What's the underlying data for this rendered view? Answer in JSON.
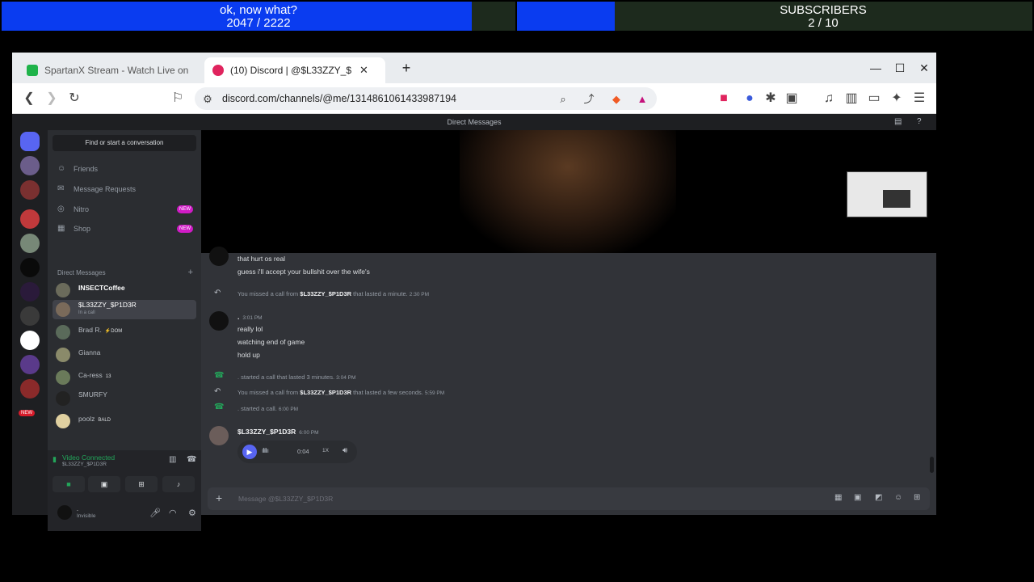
{
  "overlay": {
    "goal1": {
      "title": "ok, now what?",
      "progress": "2047 / 2222",
      "fill_fraction": 0.915
    },
    "goal2": {
      "title": "SUBSCRIBERS",
      "progress": "2 / 10",
      "fill_fraction": 0.19
    },
    "accent_color": "#0a3cf0"
  },
  "browser": {
    "tabs": [
      {
        "title": "SpartanX Stream - Watch Live on",
        "favicon": "spartanx-icon"
      },
      {
        "title": "(10) Discord | @$L33ZZY_$",
        "favicon": "discord-icon"
      }
    ],
    "url": "discord.com/channels/@me/1314861061433987194",
    "window_controls": {
      "minimize": "—",
      "maximize": "☐",
      "close": "✕"
    }
  },
  "discord": {
    "header_title": "Direct Messages",
    "search_placeholder": "Find or start a conversation",
    "nav": [
      {
        "label": "Friends",
        "icon": "friends-icon"
      },
      {
        "label": "Message Requests",
        "icon": "mail-icon"
      },
      {
        "label": "Nitro",
        "icon": "nitro-icon",
        "badge": "NEW"
      },
      {
        "label": "Shop",
        "icon": "shop-icon",
        "badge": "NEW"
      }
    ],
    "dm_section_label": "Direct Messages",
    "dms": [
      {
        "name": "INSECTCoffee",
        "sub": "",
        "tag": ""
      },
      {
        "name": "$L33ZZY_$P1D3R",
        "sub": "In a call",
        "tag": ""
      },
      {
        "name": "Brad R.",
        "sub": "",
        "tag": "⚡DOM"
      },
      {
        "name": "Gianna",
        "sub": "",
        "tag": ""
      },
      {
        "name": "Ca-ress",
        "sub": "",
        "tag": "13"
      },
      {
        "name": "SMURFY",
        "sub": "",
        "tag": ""
      },
      {
        "name": "poolz",
        "sub": "",
        "tag": "BALD"
      }
    ],
    "voice": {
      "status": "Video Connected",
      "channel": "$L33ZZY_$P1D3R"
    },
    "user": {
      "name": ".",
      "status": "Invisible"
    },
    "messages": {
      "line1": "that hurt os real",
      "line2": "guess i'll accept your bullshit over the wife's",
      "missed1_prefix": "You missed a call from",
      "missed1_user": "$L33ZZY_$P1D3R",
      "missed1_suffix": "that lasted a minute.",
      "missed1_time": "2:30 PM",
      "group_author": ".",
      "group_time": "3:01 PM",
      "line3": "really lol",
      "line4": "watching end of game",
      "line5": "hold up",
      "call1_text": ". started a call that lasted 3 minutes.",
      "call1_time": "3:04 PM",
      "missed2_prefix": "You missed a call from",
      "missed2_user": "$L33ZZY_$P1D3R",
      "missed2_suffix": "that lasted a few seconds.",
      "missed2_time": "5:59 PM",
      "call2_text": ". started a call.",
      "call2_time": "6:00 PM",
      "last_author": "$L33ZZY_$P1D3R",
      "last_time": "6:00 PM",
      "voice_duration": "0:04",
      "voice_speed": "1X"
    },
    "composer_placeholder": "Message @$L33ZZY_$P1D3R",
    "new_badge": "NEW"
  }
}
